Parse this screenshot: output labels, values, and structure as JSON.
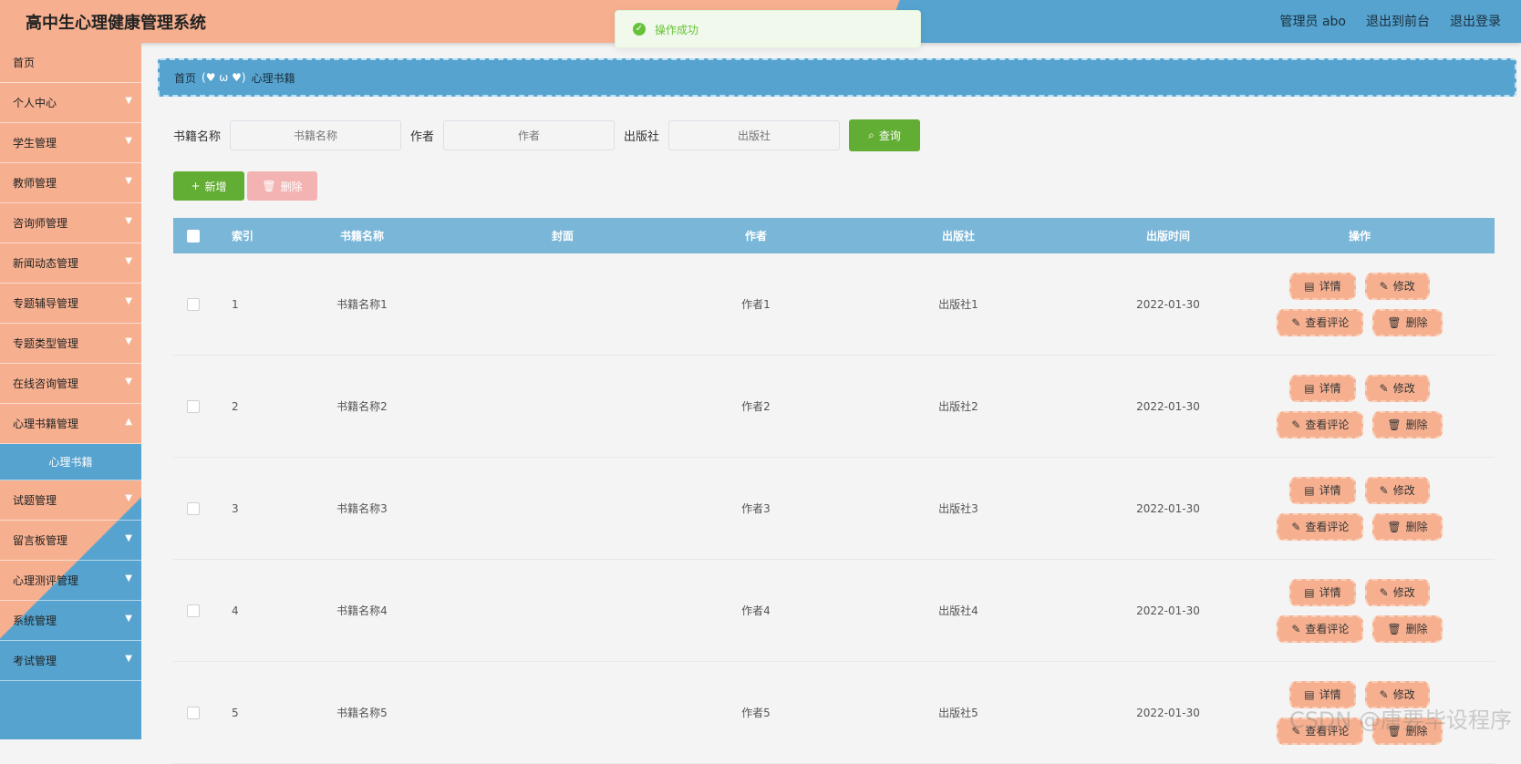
{
  "app": {
    "title": "高中生心理健康管理系统"
  },
  "topnav": {
    "admin": "管理员 abo",
    "front": "退出到前台",
    "logout": "退出登录"
  },
  "toast": {
    "message": "操作成功"
  },
  "sidebar": {
    "items": [
      {
        "label": "首页"
      },
      {
        "label": "个人中心"
      },
      {
        "label": "学生管理"
      },
      {
        "label": "教师管理"
      },
      {
        "label": "咨询师管理"
      },
      {
        "label": "新闻动态管理"
      },
      {
        "label": "专题辅导管理"
      },
      {
        "label": "专题类型管理"
      },
      {
        "label": "在线咨询管理"
      },
      {
        "label": "心理书籍管理"
      },
      {
        "label": "试题管理"
      },
      {
        "label": "留言板管理"
      },
      {
        "label": "心理测评管理"
      },
      {
        "label": "系统管理"
      },
      {
        "label": "考试管理"
      }
    ],
    "sub_active": "心理书籍"
  },
  "breadcrumb": {
    "home": "首页",
    "heart": "(♥ ω ♥)",
    "current": "心理书籍"
  },
  "search": {
    "name_label": "书籍名称",
    "name_placeholder": "书籍名称",
    "author_label": "作者",
    "author_placeholder": "作者",
    "pub_label": "出版社",
    "pub_placeholder": "出版社",
    "query_label": "查询"
  },
  "actions": {
    "add": "新增",
    "delete": "删除"
  },
  "table": {
    "columns": {
      "index": "索引",
      "name": "书籍名称",
      "cover": "封面",
      "author": "作者",
      "publisher": "出版社",
      "date": "出版时间",
      "ops": "操作"
    },
    "ops": {
      "detail": "详情",
      "edit": "修改",
      "comments": "查看评论",
      "delete": "删除"
    },
    "rows": [
      {
        "index": "1",
        "name": "书籍名称1",
        "author": "作者1",
        "publisher": "出版社1",
        "date": "2022-01-30"
      },
      {
        "index": "2",
        "name": "书籍名称2",
        "author": "作者2",
        "publisher": "出版社2",
        "date": "2022-01-30"
      },
      {
        "index": "3",
        "name": "书籍名称3",
        "author": "作者3",
        "publisher": "出版社3",
        "date": "2022-01-30"
      },
      {
        "index": "4",
        "name": "书籍名称4",
        "author": "作者4",
        "publisher": "出版社4",
        "date": "2022-01-30"
      },
      {
        "index": "5",
        "name": "书籍名称5",
        "author": "作者5",
        "publisher": "出版社5",
        "date": "2022-01-30"
      }
    ]
  },
  "watermark": "CSDN @唐要毕设程序"
}
